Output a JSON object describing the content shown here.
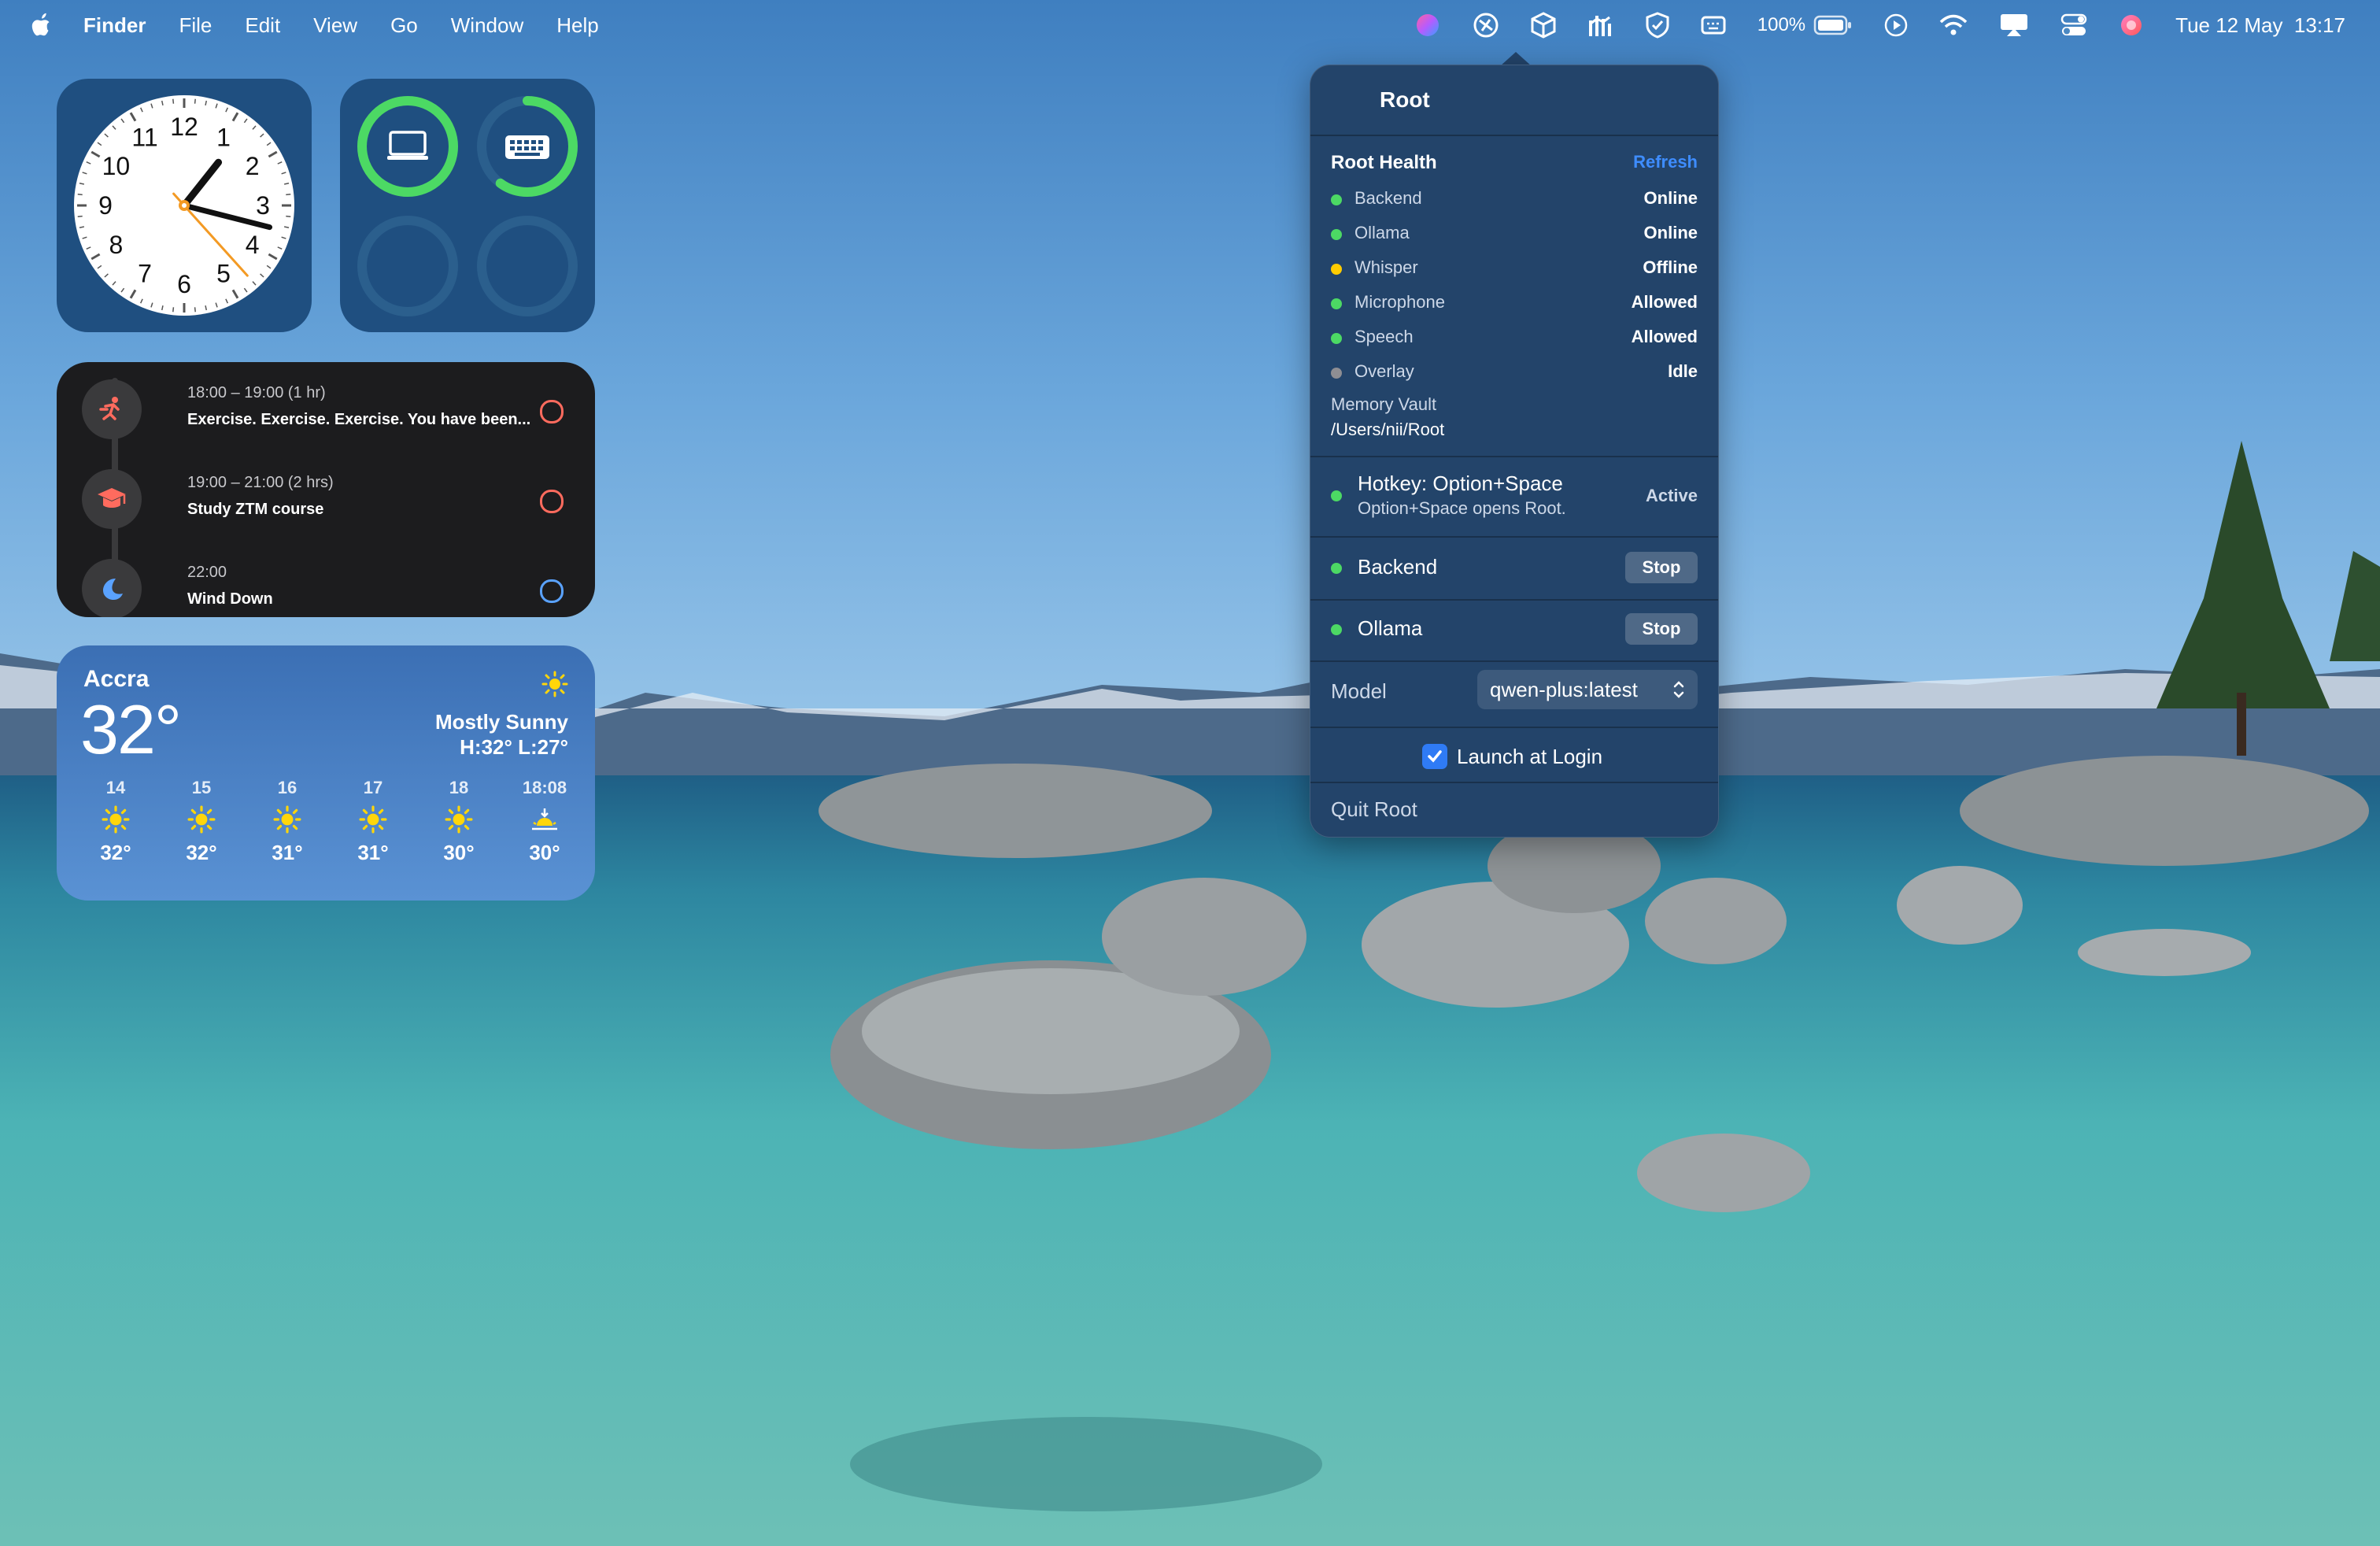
{
  "menubar": {
    "app_name": "Finder",
    "menus": [
      "File",
      "Edit",
      "View",
      "Go",
      "Window",
      "Help"
    ],
    "battery": "100%",
    "datetime": "Tue 12 May  13:17",
    "status_icons": [
      "siri-colored-icon",
      "root-app-icon",
      "box-icon",
      "network-icon",
      "shield-icon",
      "keyboard-brightness-icon",
      "battery-icon",
      "play-icon",
      "wifi-icon",
      "airplay-icon",
      "control-center-icon",
      "siri-icon"
    ]
  },
  "clock": {
    "numbers": [
      "12",
      "1",
      "2",
      "3",
      "4",
      "5",
      "6",
      "7",
      "8",
      "9",
      "10",
      "11"
    ],
    "hour": 1,
    "minute": 17,
    "second": 23
  },
  "batteries": {
    "devices": [
      {
        "icon": "laptop-icon",
        "level": 1.0
      },
      {
        "icon": "keyboard-icon",
        "level": 0.6
      }
    ]
  },
  "calendar": {
    "events": [
      {
        "time": "18:00 – 19:00 (1 hr)",
        "title": "Exercise. Exercise. Exercise. You have been...",
        "icon": "running-figure-icon",
        "color": "#ff6b5e"
      },
      {
        "time": "19:00 – 21:00 (2 hrs)",
        "title": "Study ZTM course",
        "icon": "graduation-cap-icon",
        "color": "#ff6b5e"
      },
      {
        "time": "22:00",
        "title": "Wind Down",
        "icon": "moon-icon",
        "color": "#5aa2ff"
      }
    ]
  },
  "weather": {
    "city": "Accra",
    "temp": "32°",
    "condition": "Mostly Sunny",
    "hilo": "H:32° L:27°",
    "forecast": [
      {
        "label": "14",
        "temp": "32°",
        "icon": "sun-icon"
      },
      {
        "label": "15",
        "temp": "32°",
        "icon": "sun-icon"
      },
      {
        "label": "16",
        "temp": "31°",
        "icon": "sun-icon"
      },
      {
        "label": "17",
        "temp": "31°",
        "icon": "sun-icon"
      },
      {
        "label": "18",
        "temp": "30°",
        "icon": "sun-icon"
      },
      {
        "label": "18:08",
        "temp": "30°",
        "icon": "sunset-icon"
      }
    ]
  },
  "root_popover": {
    "title": "Root",
    "health": {
      "heading": "Root Health",
      "refresh_label": "Refresh",
      "items": [
        {
          "label": "Backend",
          "value": "Online",
          "status_color": "#4cd964"
        },
        {
          "label": "Ollama",
          "value": "Online",
          "status_color": "#4cd964"
        },
        {
          "label": "Whisper",
          "value": "Offline",
          "status_color": "#ffcc00"
        },
        {
          "label": "Microphone",
          "value": "Allowed",
          "status_color": "#4cd964"
        },
        {
          "label": "Speech",
          "value": "Allowed",
          "status_color": "#4cd964"
        },
        {
          "label": "Overlay",
          "value": "Idle",
          "status_color": "#8e8e93"
        }
      ],
      "vault_label": "Memory Vault",
      "vault_path": "/Users/nii/Root"
    },
    "hotkey": {
      "title": "Hotkey: Option+Space",
      "subtitle": "Option+Space opens Root.",
      "status": "Active"
    },
    "services": [
      {
        "name": "Backend",
        "button": "Stop"
      },
      {
        "name": "Ollama",
        "button": "Stop"
      }
    ],
    "model": {
      "label": "Model",
      "value": "qwen-plus:latest"
    },
    "launch_at_login": {
      "label": "Launch at Login",
      "checked": true
    },
    "quit_label": "Quit Root"
  }
}
